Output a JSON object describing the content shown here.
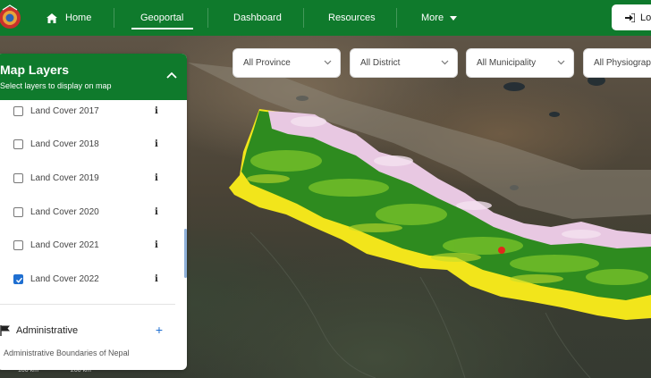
{
  "nav": {
    "home": "Home",
    "geoportal": "Geoportal",
    "dashboard": "Dashboard",
    "resources": "Resources",
    "more": "More",
    "login": "Lo"
  },
  "filters": {
    "province": "All Province",
    "district": "All District",
    "municipality": "All Municipality",
    "physiographic": "All Physiograph"
  },
  "panel": {
    "title": "Map Layers",
    "subtitle": "Select layers to display on map",
    "layers": [
      {
        "label": "Land Cover 2017",
        "checked": false
      },
      {
        "label": "Land Cover 2018",
        "checked": false
      },
      {
        "label": "Land Cover 2019",
        "checked": false
      },
      {
        "label": "Land Cover 2020",
        "checked": false
      },
      {
        "label": "Land Cover 2021",
        "checked": false
      },
      {
        "label": "Land Cover 2022",
        "checked": true
      }
    ],
    "info_glyph": "i",
    "group": {
      "label": "Administrative",
      "description": "Administrative Boundaries of Nepal",
      "add_glyph": "+"
    }
  },
  "scale": [
    "100 km",
    "200 km"
  ],
  "colors": {
    "brand_green": "#0f7a2c",
    "checkbox_blue": "#1f6fd1",
    "land_forest": "#2e8b1f",
    "land_agri": "#f2e51b",
    "land_snow": "#e8c8e2",
    "land_urban": "#e0281c"
  },
  "icons": {
    "home": "home-icon",
    "login": "login-icon",
    "chevron": "chevron-down-icon",
    "flag": "flag-icon"
  }
}
